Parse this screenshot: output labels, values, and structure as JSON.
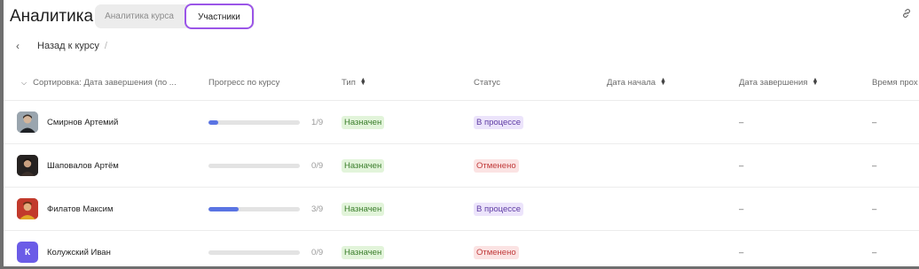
{
  "header": {
    "title": "Аналитика",
    "tabs": [
      {
        "label": "Аналитика курса",
        "active": false
      },
      {
        "label": "Участники",
        "active": true
      }
    ],
    "link_icon": "link-icon"
  },
  "breadcrumb": {
    "back_label": "Назад к курсу",
    "separator": "/"
  },
  "table": {
    "columns": {
      "sort": "Сортировка: Дата завершения (по ...",
      "progress": "Прогресс по курсу",
      "type": "Тип",
      "status": "Статус",
      "start_date": "Дата начала",
      "end_date": "Дата завершения",
      "time": "Время прох"
    },
    "rows": [
      {
        "name": "Смирнов Артемий",
        "avatar": "photo",
        "progress_text": "1/9",
        "progress": 0.111,
        "type": "Назначен",
        "status": "В процессе",
        "status_kind": "progress",
        "start": "–",
        "end": "–",
        "time": "–"
      },
      {
        "name": "Шаповалов Артём",
        "avatar": "photo",
        "progress_text": "0/9",
        "progress": 0,
        "type": "Назначен",
        "status": "Отменено",
        "status_kind": "cancelled",
        "start": "–",
        "end": "–",
        "time": "–"
      },
      {
        "name": "Филатов Максим",
        "avatar": "photo",
        "progress_text": "3/9",
        "progress": 0.333,
        "type": "Назначен",
        "status": "В процессе",
        "status_kind": "progress",
        "start": "–",
        "end": "–",
        "time": "–"
      },
      {
        "name": "Колужский Иван",
        "avatar": "letter",
        "avatar_letter": "К",
        "progress_text": "0/9",
        "progress": 0,
        "type": "Назначен",
        "status": "Отменено",
        "status_kind": "cancelled",
        "start": "–",
        "end": "–",
        "time": "–"
      }
    ]
  },
  "colors": {
    "accent_outline": "#9b55e8",
    "progress_fill": "#5a74e3",
    "avatar_letter_bg": "#6b5ce7"
  }
}
